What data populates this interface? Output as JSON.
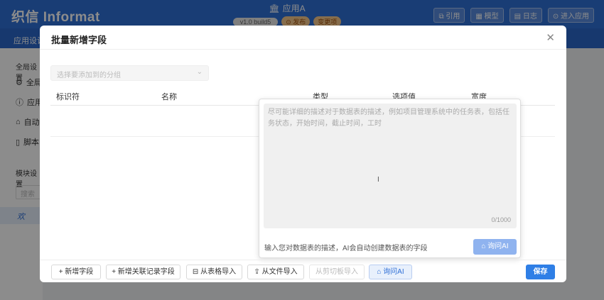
{
  "app": {
    "logo": "织信 Informat",
    "app_name": "应用A",
    "version": "v1.0 build5",
    "publish_label": "发布",
    "changes_label": "变更项",
    "header_buttons": [
      "引用",
      "模型",
      "日志",
      "进入应用"
    ]
  },
  "nav": {
    "design_label": "应用设计"
  },
  "sidebar": {
    "global_label": "全局设置",
    "items": [
      "全局",
      "应用",
      "自动",
      "脚本"
    ],
    "module_label": "模块设置",
    "search_placeholder": "搜索",
    "selected_item": "欢"
  },
  "modal": {
    "title": "批量新增字段",
    "group_placeholder": "选择要添加到的分组",
    "columns": [
      "标识符",
      "名称",
      "类型",
      "选项值",
      "宽度"
    ],
    "ai_popover": {
      "placeholder": "尽可能详细的描述对于数据表的描述，例如项目管理系统中的任务表，包括任务状态，开始时间，截止时间，工时",
      "counter": "0/1000",
      "hint": "输入您对数据表的描述，AI会自动创建数据表的字段",
      "button": "询问AI"
    },
    "footer": {
      "add_field": "+ 新增字段",
      "add_related": "+ 新增关联记录字段",
      "import_table": "从表格导入",
      "import_file": "从文件导入",
      "import_clipboard": "从剪切板导入",
      "ask_ai": "询问AI",
      "save": "保存"
    }
  }
}
